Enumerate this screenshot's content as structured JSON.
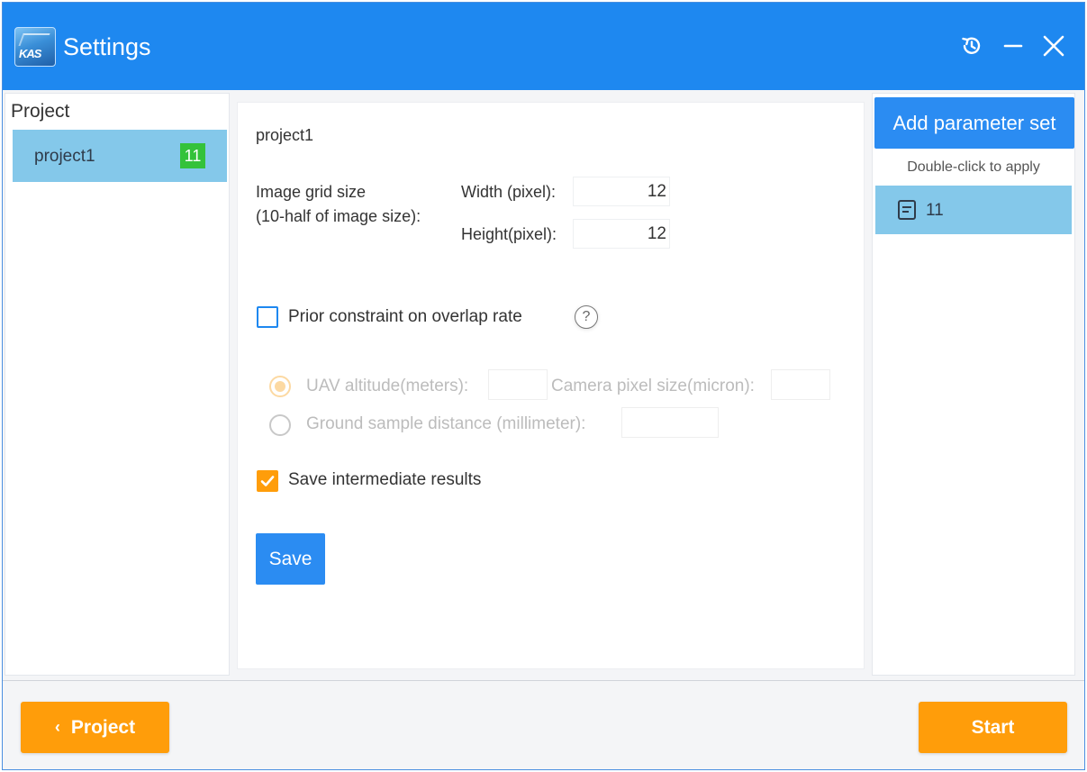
{
  "window": {
    "title": "Settings",
    "logo_text": "KAS",
    "controls": {
      "history_icon": "history-icon",
      "minimize_icon": "minimize-icon",
      "close_icon": "close-icon"
    }
  },
  "left_panel": {
    "heading": "Project",
    "projects": [
      {
        "name": "project1",
        "badge": "11",
        "selected": true
      }
    ]
  },
  "main": {
    "project_title": "project1",
    "image_grid": {
      "label_line1": "Image grid size",
      "label_line2": "(10-half of image size):",
      "width_label": "Width (pixel):",
      "width_value": "12",
      "height_label": "Height(pixel):",
      "height_value": "12"
    },
    "overlap_constraint": {
      "label": "Prior constraint on overlap rate",
      "checked": false,
      "help_glyph": "?"
    },
    "constraint_options": {
      "uav_altitude_label": "UAV altitude(meters):",
      "uav_altitude_value": "",
      "camera_pixel_label": "Camera pixel size(micron):",
      "camera_pixel_value": "",
      "gsd_label": "Ground sample distance (millimeter):",
      "gsd_value": "",
      "selected": "uav_altitude",
      "enabled": false
    },
    "save_intermediate": {
      "label": "Save intermediate results",
      "checked": true
    },
    "save_button": "Save"
  },
  "right_panel": {
    "add_button": "Add parameter set",
    "hint": "Double-click to apply",
    "param_sets": [
      {
        "name": "11",
        "icon": "document-icon",
        "selected": true
      }
    ]
  },
  "footer": {
    "back_chevron": "‹",
    "back_button": "Project",
    "start_button": "Start"
  },
  "colors": {
    "title_bar": "#1e88f0",
    "primary_button": "#2b8cf2",
    "selected_item": "#84c8ea",
    "badge": "#34c23a",
    "accent_orange": "#ff9d0a",
    "disabled_text": "#bcbcbc"
  }
}
